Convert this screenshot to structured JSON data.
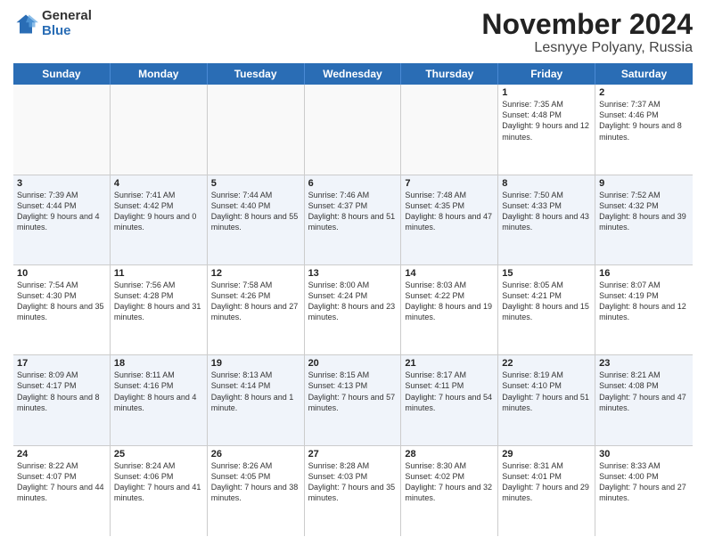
{
  "logo": {
    "general": "General",
    "blue": "Blue"
  },
  "header": {
    "month": "November 2024",
    "location": "Lesnyye Polyany, Russia"
  },
  "weekdays": [
    "Sunday",
    "Monday",
    "Tuesday",
    "Wednesday",
    "Thursday",
    "Friday",
    "Saturday"
  ],
  "rows": [
    [
      {
        "day": "",
        "info": ""
      },
      {
        "day": "",
        "info": ""
      },
      {
        "day": "",
        "info": ""
      },
      {
        "day": "",
        "info": ""
      },
      {
        "day": "",
        "info": ""
      },
      {
        "day": "1",
        "info": "Sunrise: 7:35 AM\nSunset: 4:48 PM\nDaylight: 9 hours and 12 minutes."
      },
      {
        "day": "2",
        "info": "Sunrise: 7:37 AM\nSunset: 4:46 PM\nDaylight: 9 hours and 8 minutes."
      }
    ],
    [
      {
        "day": "3",
        "info": "Sunrise: 7:39 AM\nSunset: 4:44 PM\nDaylight: 9 hours and 4 minutes."
      },
      {
        "day": "4",
        "info": "Sunrise: 7:41 AM\nSunset: 4:42 PM\nDaylight: 9 hours and 0 minutes."
      },
      {
        "day": "5",
        "info": "Sunrise: 7:44 AM\nSunset: 4:40 PM\nDaylight: 8 hours and 55 minutes."
      },
      {
        "day": "6",
        "info": "Sunrise: 7:46 AM\nSunset: 4:37 PM\nDaylight: 8 hours and 51 minutes."
      },
      {
        "day": "7",
        "info": "Sunrise: 7:48 AM\nSunset: 4:35 PM\nDaylight: 8 hours and 47 minutes."
      },
      {
        "day": "8",
        "info": "Sunrise: 7:50 AM\nSunset: 4:33 PM\nDaylight: 8 hours and 43 minutes."
      },
      {
        "day": "9",
        "info": "Sunrise: 7:52 AM\nSunset: 4:32 PM\nDaylight: 8 hours and 39 minutes."
      }
    ],
    [
      {
        "day": "10",
        "info": "Sunrise: 7:54 AM\nSunset: 4:30 PM\nDaylight: 8 hours and 35 minutes."
      },
      {
        "day": "11",
        "info": "Sunrise: 7:56 AM\nSunset: 4:28 PM\nDaylight: 8 hours and 31 minutes."
      },
      {
        "day": "12",
        "info": "Sunrise: 7:58 AM\nSunset: 4:26 PM\nDaylight: 8 hours and 27 minutes."
      },
      {
        "day": "13",
        "info": "Sunrise: 8:00 AM\nSunset: 4:24 PM\nDaylight: 8 hours and 23 minutes."
      },
      {
        "day": "14",
        "info": "Sunrise: 8:03 AM\nSunset: 4:22 PM\nDaylight: 8 hours and 19 minutes."
      },
      {
        "day": "15",
        "info": "Sunrise: 8:05 AM\nSunset: 4:21 PM\nDaylight: 8 hours and 15 minutes."
      },
      {
        "day": "16",
        "info": "Sunrise: 8:07 AM\nSunset: 4:19 PM\nDaylight: 8 hours and 12 minutes."
      }
    ],
    [
      {
        "day": "17",
        "info": "Sunrise: 8:09 AM\nSunset: 4:17 PM\nDaylight: 8 hours and 8 minutes."
      },
      {
        "day": "18",
        "info": "Sunrise: 8:11 AM\nSunset: 4:16 PM\nDaylight: 8 hours and 4 minutes."
      },
      {
        "day": "19",
        "info": "Sunrise: 8:13 AM\nSunset: 4:14 PM\nDaylight: 8 hours and 1 minute."
      },
      {
        "day": "20",
        "info": "Sunrise: 8:15 AM\nSunset: 4:13 PM\nDaylight: 7 hours and 57 minutes."
      },
      {
        "day": "21",
        "info": "Sunrise: 8:17 AM\nSunset: 4:11 PM\nDaylight: 7 hours and 54 minutes."
      },
      {
        "day": "22",
        "info": "Sunrise: 8:19 AM\nSunset: 4:10 PM\nDaylight: 7 hours and 51 minutes."
      },
      {
        "day": "23",
        "info": "Sunrise: 8:21 AM\nSunset: 4:08 PM\nDaylight: 7 hours and 47 minutes."
      }
    ],
    [
      {
        "day": "24",
        "info": "Sunrise: 8:22 AM\nSunset: 4:07 PM\nDaylight: 7 hours and 44 minutes."
      },
      {
        "day": "25",
        "info": "Sunrise: 8:24 AM\nSunset: 4:06 PM\nDaylight: 7 hours and 41 minutes."
      },
      {
        "day": "26",
        "info": "Sunrise: 8:26 AM\nSunset: 4:05 PM\nDaylight: 7 hours and 38 minutes."
      },
      {
        "day": "27",
        "info": "Sunrise: 8:28 AM\nSunset: 4:03 PM\nDaylight: 7 hours and 35 minutes."
      },
      {
        "day": "28",
        "info": "Sunrise: 8:30 AM\nSunset: 4:02 PM\nDaylight: 7 hours and 32 minutes."
      },
      {
        "day": "29",
        "info": "Sunrise: 8:31 AM\nSunset: 4:01 PM\nDaylight: 7 hours and 29 minutes."
      },
      {
        "day": "30",
        "info": "Sunrise: 8:33 AM\nSunset: 4:00 PM\nDaylight: 7 hours and 27 minutes."
      }
    ]
  ]
}
